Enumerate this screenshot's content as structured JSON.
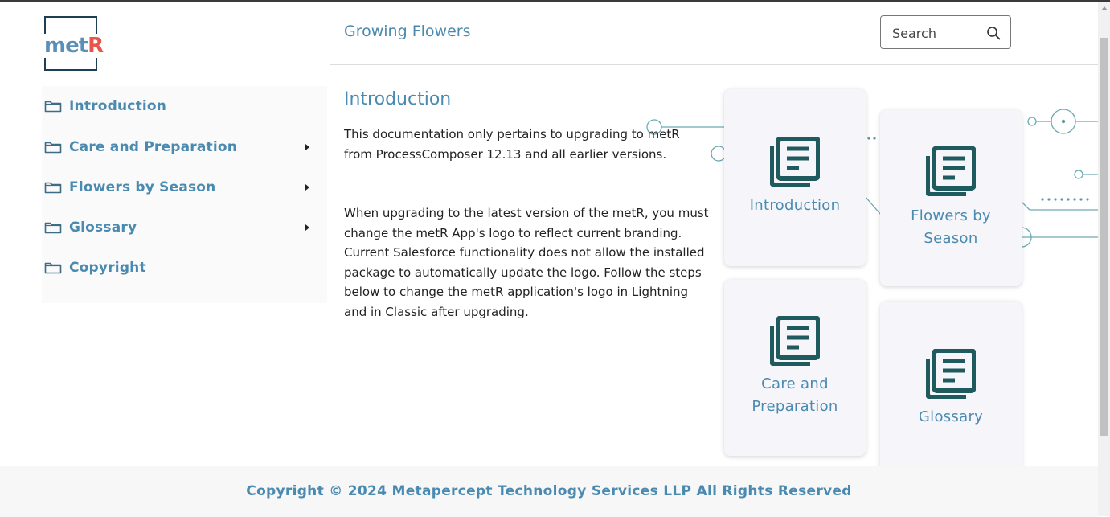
{
  "app": {
    "logo_text_met": "met",
    "logo_text_r": "R"
  },
  "sidebar": {
    "items": [
      {
        "label": "Introduction",
        "has_submenu": false
      },
      {
        "label": "Care and Preparation",
        "has_submenu": true
      },
      {
        "label": "Flowers by Season",
        "has_submenu": true
      },
      {
        "label": "Glossary",
        "has_submenu": true
      },
      {
        "label": "Copyright",
        "has_submenu": false
      }
    ]
  },
  "header": {
    "title": "Growing Flowers",
    "search_placeholder": "Search"
  },
  "main": {
    "section_title": "Introduction",
    "paragraphs": [
      "This documentation only pertains to upgrading to metR from ProcessComposer 12.13 and all earlier versions.",
      "When upgrading to the latest version of the metR, you must change the metR App's logo to reflect current branding. Current Salesforce functionality does not allow the installed package to automatically update the logo. Follow the steps below to change the metR application's logo in Lightning and in Classic after upgrading."
    ],
    "cards": [
      {
        "label": "Introduction",
        "icon": "book-icon"
      },
      {
        "label": "Flowers by Season",
        "icon": "book-icon"
      },
      {
        "label": "Care and Preparation",
        "icon": "book-icon"
      },
      {
        "label": "Glossary",
        "icon": "book-icon"
      }
    ]
  },
  "footer": {
    "copyright": "Copyright © 2024 Metapercept Technology Services LLP All Rights Reserved"
  },
  "colors": {
    "accent": "#4a8ab0",
    "icon": "#1f5a5e",
    "logo_blue": "#5b8fb7",
    "logo_red": "#e6564a",
    "logo_frame": "#1e3e55"
  }
}
